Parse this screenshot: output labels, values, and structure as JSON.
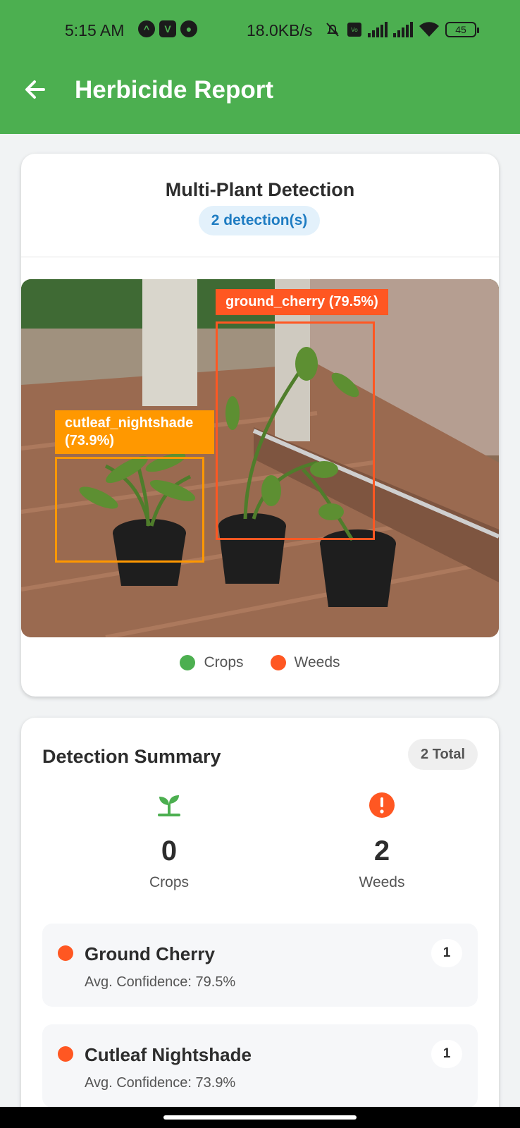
{
  "status_bar": {
    "time": "5:15 AM",
    "net_speed": "18.0KB/s",
    "battery": "45",
    "icons": [
      "app-a-icon",
      "app-v-icon",
      "app-round-icon",
      "mute-bell-icon",
      "volte-icon",
      "signal-icon",
      "signal-icon",
      "wifi-icon",
      "battery-icon"
    ]
  },
  "appbar": {
    "title": "Herbicide Report",
    "back_icon": "arrow-left-icon"
  },
  "detection_card": {
    "title": "Multi-Plant Detection",
    "count_pill": "2 detection(s)",
    "boxes": [
      {
        "label": "ground_cherry (79.5%)",
        "color": "#ff5722"
      },
      {
        "label_line1": "cutleaf_nightshade",
        "label_line2": "(73.9%)",
        "color": "#ff9800"
      }
    ],
    "legend": [
      {
        "label": "Crops",
        "color": "#4caf50"
      },
      {
        "label": "Weeds",
        "color": "#ff5722"
      }
    ]
  },
  "summary": {
    "title": "Detection Summary",
    "total": "2 Total",
    "crops": {
      "value": "0",
      "label": "Crops",
      "icon": "sprout-icon",
      "color": "#4caf50"
    },
    "weeds": {
      "value": "2",
      "label": "Weeds",
      "icon": "alert-icon",
      "color": "#ff5722"
    },
    "items": [
      {
        "name": "Ground Cherry",
        "confidence": "Avg. Confidence: 79.5%",
        "count": "1"
      },
      {
        "name": "Cutleaf Nightshade",
        "confidence": "Avg. Confidence: 73.9%",
        "count": "1"
      }
    ]
  }
}
